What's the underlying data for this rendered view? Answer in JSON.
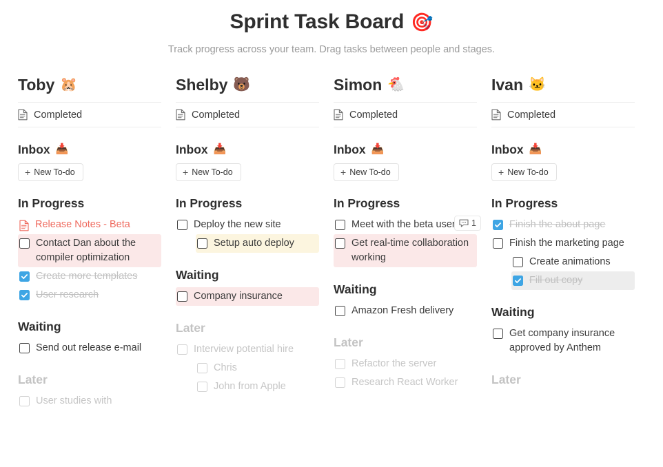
{
  "header": {
    "title": "Sprint Task Board",
    "title_emoji": "🎯",
    "subtitle": "Track progress across your team.  Drag tasks between people and stages."
  },
  "labels": {
    "completed": "Completed",
    "new_todo": "New To-do",
    "plus": "+",
    "inbox_emoji": "📥",
    "section_in_progress": "In Progress",
    "section_waiting": "Waiting",
    "section_later": "Later",
    "section_inbox": "Inbox"
  },
  "colors": {
    "checkbox_checked": "#3ea5e4",
    "link_red": "#ef6a5e",
    "highlight_pink": "#fbe8e8",
    "highlight_cream": "#fcf5df",
    "highlight_grey": "#ededed",
    "muted_text": "#c6c6c6",
    "title_text": "#2f2f2f",
    "subtitle_text": "#9a9a9a"
  },
  "columns": [
    {
      "name": "Toby",
      "emoji": "🐹",
      "sections": [
        {
          "title": "In Progress",
          "muted": false,
          "tasks": [
            {
              "label": "Release Notes - Beta",
              "type": "link",
              "checked": false,
              "indent": 0,
              "highlight": "none",
              "dim": false
            },
            {
              "label": "Contact Dan about the compiler optimization",
              "type": "task",
              "checked": false,
              "indent": 0,
              "highlight": "pink",
              "dim": false
            },
            {
              "label": "Create more templates",
              "type": "task",
              "checked": true,
              "indent": 0,
              "highlight": "none",
              "dim": false
            },
            {
              "label": "User research",
              "type": "task",
              "checked": true,
              "indent": 0,
              "highlight": "none",
              "dim": false
            }
          ]
        },
        {
          "title": "Waiting",
          "muted": false,
          "tasks": [
            {
              "label": "Send out release e-mail",
              "type": "task",
              "checked": false,
              "indent": 0,
              "highlight": "none",
              "dim": false
            }
          ]
        },
        {
          "title": "Later",
          "muted": true,
          "tasks": [
            {
              "label": "User studies with",
              "type": "task",
              "checked": false,
              "indent": 0,
              "highlight": "none",
              "dim": true
            }
          ]
        }
      ]
    },
    {
      "name": "Shelby",
      "emoji": "🐻",
      "sections": [
        {
          "title": "In Progress",
          "muted": false,
          "tasks": [
            {
              "label": "Deploy the new site",
              "type": "task",
              "checked": false,
              "indent": 0,
              "highlight": "none",
              "dim": false
            },
            {
              "label": "Setup auto deploy",
              "type": "task",
              "checked": false,
              "indent": 1,
              "highlight": "cream",
              "dim": false
            }
          ]
        },
        {
          "title": "Waiting",
          "muted": false,
          "tasks": [
            {
              "label": "Company insurance",
              "type": "task",
              "checked": false,
              "indent": 0,
              "highlight": "pink",
              "dim": false
            }
          ]
        },
        {
          "title": "Later",
          "muted": true,
          "tasks": [
            {
              "label": "Interview potential hire",
              "type": "task",
              "checked": false,
              "indent": 0,
              "highlight": "none",
              "dim": true
            },
            {
              "label": "Chris",
              "type": "task",
              "checked": false,
              "indent": 1,
              "highlight": "none",
              "dim": true
            },
            {
              "label": "John from Apple",
              "type": "task",
              "checked": false,
              "indent": 1,
              "highlight": "none",
              "dim": true
            }
          ]
        }
      ]
    },
    {
      "name": "Simon",
      "emoji": "🐔",
      "sections": [
        {
          "title": "In Progress",
          "muted": false,
          "tasks": [
            {
              "label": "Meet with the beta users",
              "type": "task",
              "checked": false,
              "indent": 0,
              "highlight": "none",
              "dim": false,
              "comment_count": "1"
            },
            {
              "label": "Get real-time collaboration working",
              "type": "task",
              "checked": false,
              "indent": 0,
              "highlight": "pink",
              "dim": false
            }
          ]
        },
        {
          "title": "Waiting",
          "muted": false,
          "tasks": [
            {
              "label": "Amazon Fresh delivery",
              "type": "task",
              "checked": false,
              "indent": 0,
              "highlight": "none",
              "dim": false
            }
          ]
        },
        {
          "title": "Later",
          "muted": true,
          "tasks": [
            {
              "label": "Refactor the server",
              "type": "task",
              "checked": false,
              "indent": 0,
              "highlight": "none",
              "dim": true
            },
            {
              "label": "Research React Worker",
              "type": "task",
              "checked": false,
              "indent": 0,
              "highlight": "none",
              "dim": true
            }
          ]
        }
      ]
    },
    {
      "name": "Ivan",
      "emoji": "🐱",
      "sections": [
        {
          "title": "In Progress",
          "muted": false,
          "tasks": [
            {
              "label": "Finish the about page",
              "type": "task",
              "checked": true,
              "indent": 0,
              "highlight": "none",
              "dim": false
            },
            {
              "label": "Finish the marketing page",
              "type": "task",
              "checked": false,
              "indent": 0,
              "highlight": "none",
              "dim": false
            },
            {
              "label": "Create animations",
              "type": "task",
              "checked": false,
              "indent": 1,
              "highlight": "none",
              "dim": false
            },
            {
              "label": "Fill out copy",
              "type": "task",
              "checked": true,
              "indent": 1,
              "highlight": "grey",
              "dim": false
            }
          ]
        },
        {
          "title": "Waiting",
          "muted": false,
          "tasks": [
            {
              "label": "Get company insurance approved by Anthem",
              "type": "task",
              "checked": false,
              "indent": 0,
              "highlight": "none",
              "dim": false
            }
          ]
        },
        {
          "title": "Later",
          "muted": true,
          "tasks": []
        }
      ]
    }
  ]
}
